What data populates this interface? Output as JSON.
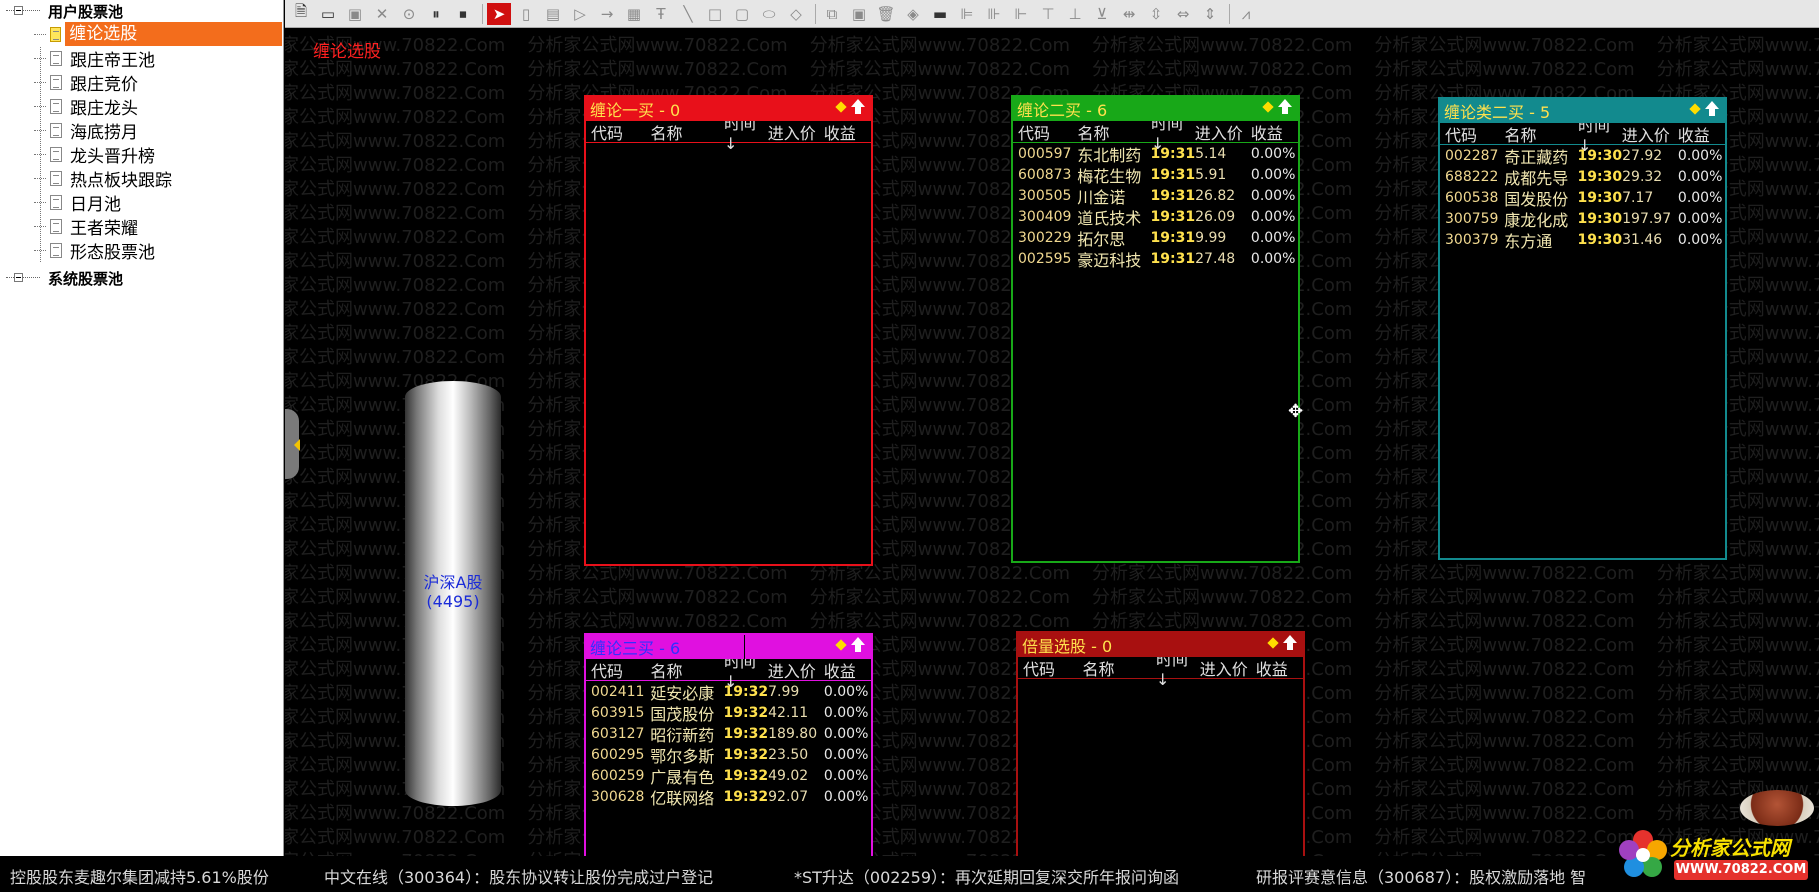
{
  "tree": {
    "root1": "用户股票池",
    "items": [
      "缠论选股",
      "跟庄帝王池",
      "跟庄竞价",
      "跟庄龙头",
      "海底捞月",
      "龙头晋升榜",
      "热点板块跟踪",
      "日月池",
      "王者荣耀",
      "形态股票池"
    ],
    "root2": "系统股票池"
  },
  "canvas": {
    "title": "缠论选股",
    "watermark": "分析家公式网www.70822.Com",
    "cylinder_label": "沪深A股",
    "cylinder_count": "(4495)"
  },
  "columns": {
    "code": "代码",
    "name": "名称",
    "time": "时间↓",
    "price": "进入价",
    "ret": "收益"
  },
  "panels": {
    "p1": {
      "title": "缠论一买 - 0",
      "color": "#e8101a",
      "rows": []
    },
    "p2": {
      "title": "缠论二买 - 6",
      "color": "#18a818",
      "rows": [
        [
          "000597",
          "东北制药",
          "19:31",
          "5.14",
          "0.00%"
        ],
        [
          "600873",
          "梅花生物",
          "19:31",
          "5.91",
          "0.00%"
        ],
        [
          "300505",
          "川金诺",
          "19:31",
          "26.82",
          "0.00%"
        ],
        [
          "300409",
          "道氏技术",
          "19:31",
          "26.09",
          "0.00%"
        ],
        [
          "300229",
          "拓尔思",
          "19:31",
          "9.99",
          "0.00%"
        ],
        [
          "002595",
          "豪迈科技",
          "19:31",
          "27.48",
          "0.00%"
        ]
      ]
    },
    "p3": {
      "title": "缠论类二买 - 5",
      "color": "#128a8e",
      "rows": [
        [
          "002287",
          "奇正藏药",
          "19:30",
          "27.92",
          "0.00%"
        ],
        [
          "688222",
          "成都先导",
          "19:30",
          "29.32",
          "0.00%"
        ],
        [
          "600538",
          "国发股份",
          "19:30",
          "7.17",
          "0.00%"
        ],
        [
          "300759",
          "康龙化成",
          "19:30",
          "197.97",
          "0.00%"
        ],
        [
          "300379",
          "东方通",
          "19:30",
          "31.46",
          "0.00%"
        ]
      ]
    },
    "p4": {
      "title": "缠论三买 - 6",
      "color": "#e010e0",
      "rows": [
        [
          "002411",
          "延安必康",
          "19:32",
          "7.99",
          "0.00%"
        ],
        [
          "603915",
          "国茂股份",
          "19:32",
          "42.11",
          "0.00%"
        ],
        [
          "603127",
          "昭衍新药",
          "19:32",
          "189.80",
          "0.00%"
        ],
        [
          "600295",
          "鄂尔多斯",
          "19:32",
          "23.50",
          "0.00%"
        ],
        [
          "600259",
          "广晟有色",
          "19:32",
          "49.02",
          "0.00%"
        ],
        [
          "300628",
          "亿联网络",
          "19:32",
          "92.07",
          "0.00%"
        ]
      ]
    },
    "p5": {
      "title": "倍量选股 - 0",
      "color": "#a81010",
      "rows": []
    }
  },
  "ticker": [
    "控股股东麦趣尔集团减持5.61%股份",
    "中文在线（300364）：股东协议转让股份完成过户登记",
    "*ST升达（002259）：再次延期回复深交所年报问询函",
    "研报评赛意信息（300687）：股权激励落地 智"
  ],
  "logo": {
    "text": "分析家公式网",
    "url": "WWW.70822.COM"
  },
  "colors": {
    "selected": "#f36d1c",
    "title_red": "#ff2020",
    "time_yellow": "#ffe14d"
  }
}
